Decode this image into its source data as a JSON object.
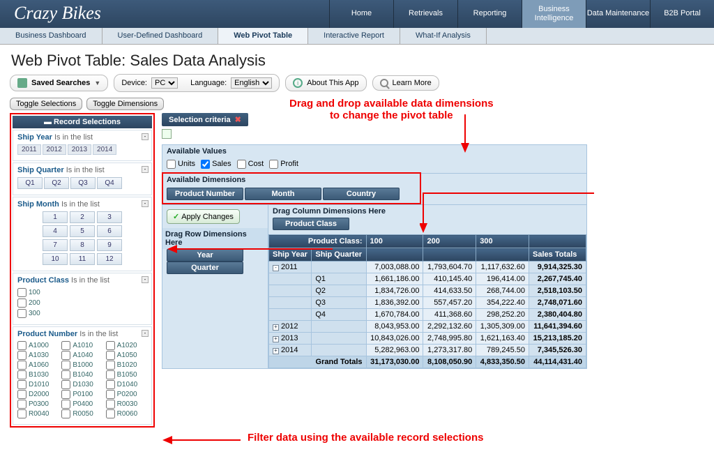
{
  "brand": "Crazy Bikes",
  "topnav": [
    "Home",
    "Retrievals",
    "Reporting",
    "Business Intelligence",
    "Data Maintenance",
    "B2B Portal"
  ],
  "topnav_active": 3,
  "subnav": [
    "Business Dashboard",
    "User-Defined Dashboard",
    "Web Pivot Table",
    "Interactive Report",
    "What-If Analysis"
  ],
  "subnav_active": 2,
  "page_title": "Web Pivot Table: Sales Data Analysis",
  "toolbar": {
    "saved_searches": "Saved Searches",
    "device_label": "Device:",
    "device_value": "PC",
    "language_label": "Language:",
    "language_value": "English",
    "about": "About This App",
    "learn": "Learn More"
  },
  "toggles": {
    "selections": "Toggle Selections",
    "dimensions": "Toggle Dimensions"
  },
  "record_selections_header": "Record Selections",
  "filters": {
    "ship_year": {
      "name": "Ship Year",
      "cond": "Is in the list",
      "values": [
        "2011",
        "2012",
        "2013",
        "2014"
      ]
    },
    "ship_quarter": {
      "name": "Ship Quarter",
      "cond": "Is in the list",
      "values": [
        "Q1",
        "Q2",
        "Q3",
        "Q4"
      ]
    },
    "ship_month": {
      "name": "Ship Month",
      "cond": "Is in the list",
      "values": [
        "1",
        "2",
        "3",
        "4",
        "5",
        "6",
        "7",
        "8",
        "9",
        "10",
        "11",
        "12"
      ]
    },
    "product_class": {
      "name": "Product Class",
      "cond": "Is in the list",
      "values": [
        "100",
        "200",
        "300"
      ]
    },
    "product_number": {
      "name": "Product Number",
      "cond": "Is in the list",
      "values": [
        "A1000",
        "A1010",
        "A1020",
        "A1030",
        "A1040",
        "A1050",
        "A1060",
        "B1000",
        "B1020",
        "B1030",
        "B1040",
        "B1050",
        "D1010",
        "D1030",
        "D1040",
        "D2000",
        "P0100",
        "P0200",
        "P0300",
        "P0400",
        "R0030",
        "R0040",
        "R0050",
        "R0060"
      ]
    }
  },
  "selection_criteria": "Selection criteria",
  "available_values": {
    "header": "Available Values",
    "options": [
      "Units",
      "Sales",
      "Cost",
      "Profit"
    ],
    "checked": "Sales"
  },
  "available_dimensions": {
    "header": "Available Dimensions",
    "items": [
      "Product Number",
      "Month",
      "Country"
    ]
  },
  "apply_changes": "Apply Changes",
  "drag_col_header": "Drag Column Dimensions Here",
  "drag_row_header": "Drag Row Dimensions Here",
  "col_dimensions": [
    "Product Class"
  ],
  "row_dimensions": [
    "Year",
    "Quarter"
  ],
  "table": {
    "col_group_label": "Product Class:",
    "col_values": [
      "100",
      "200",
      "300"
    ],
    "row_headers": [
      "Ship Year",
      "Ship Quarter"
    ],
    "totals_col": "Sales Totals",
    "grand_label": "Grand Totals",
    "rows": [
      {
        "year": "2011",
        "expand": "-",
        "q": "",
        "v": [
          "7,003,088.00",
          "1,793,604.70",
          "1,117,632.60"
        ],
        "t": "9,914,325.30"
      },
      {
        "year": "",
        "q": "Q1",
        "v": [
          "1,661,186.00",
          "410,145.40",
          "196,414.00"
        ],
        "t": "2,267,745.40"
      },
      {
        "year": "",
        "q": "Q2",
        "v": [
          "1,834,726.00",
          "414,633.50",
          "268,744.00"
        ],
        "t": "2,518,103.50"
      },
      {
        "year": "",
        "q": "Q3",
        "v": [
          "1,836,392.00",
          "557,457.20",
          "354,222.40"
        ],
        "t": "2,748,071.60"
      },
      {
        "year": "",
        "q": "Q4",
        "v": [
          "1,670,784.00",
          "411,368.60",
          "298,252.20"
        ],
        "t": "2,380,404.80"
      },
      {
        "year": "2012",
        "expand": "+",
        "q": "",
        "v": [
          "8,043,953.00",
          "2,292,132.60",
          "1,305,309.00"
        ],
        "t": "11,641,394.60"
      },
      {
        "year": "2013",
        "expand": "+",
        "q": "",
        "v": [
          "10,843,026.00",
          "2,748,995.80",
          "1,621,163.40"
        ],
        "t": "15,213,185.20"
      },
      {
        "year": "2014",
        "expand": "+",
        "q": "",
        "v": [
          "5,282,963.00",
          "1,273,317.80",
          "789,245.50"
        ],
        "t": "7,345,526.30"
      }
    ],
    "grand": [
      "31,173,030.00",
      "8,108,050.90",
      "4,833,350.50",
      "44,114,431.40"
    ]
  },
  "annotations": {
    "top": "Drag and drop available data dimensions\nto change the pivot table",
    "bottom": "Filter data using the available record selections"
  }
}
